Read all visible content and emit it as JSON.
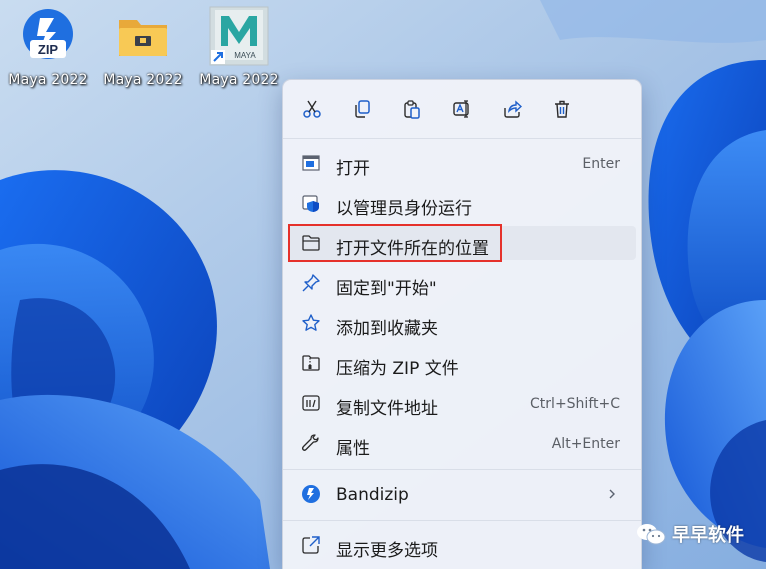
{
  "colors": {
    "accent": "#1f6fe0",
    "highlight_border": "#e5312b",
    "menu_bg": "#f0f3f9"
  },
  "desktop": {
    "icons": [
      {
        "label": "Maya 2022",
        "icon": "bandizip-zip-icon",
        "badge": "ZIP"
      },
      {
        "label": "Maya 2022",
        "icon": "folder-icon"
      },
      {
        "label": "Maya 2022",
        "icon": "maya-shortcut-icon",
        "badge": "MAYA"
      }
    ]
  },
  "context_menu": {
    "toolbar": [
      {
        "name": "cut",
        "icon": "scissors-icon"
      },
      {
        "name": "copy",
        "icon": "copy-icon"
      },
      {
        "name": "paste",
        "icon": "clipboard-icon"
      },
      {
        "name": "rename",
        "icon": "rename-icon"
      },
      {
        "name": "share",
        "icon": "share-icon"
      },
      {
        "name": "delete",
        "icon": "trash-icon"
      }
    ],
    "items": [
      {
        "label": "打开",
        "shortcut": "Enter",
        "icon": "open-window-icon"
      },
      {
        "label": "以管理员身份运行",
        "shortcut": "",
        "icon": "admin-shield-icon"
      },
      {
        "label": "打开文件所在的位置",
        "shortcut": "",
        "icon": "folder-outline-icon",
        "highlighted": true
      },
      {
        "label": "固定到\"开始\"",
        "shortcut": "",
        "icon": "pin-icon"
      },
      {
        "label": "添加到收藏夹",
        "shortcut": "",
        "icon": "star-icon"
      },
      {
        "label": "压缩为 ZIP 文件",
        "shortcut": "",
        "icon": "zip-folder-icon"
      },
      {
        "label": "复制文件地址",
        "shortcut": "Ctrl+Shift+C",
        "icon": "copy-path-icon"
      },
      {
        "label": "属性",
        "shortcut": "Alt+Enter",
        "icon": "wrench-icon"
      }
    ],
    "bandizip": {
      "label": "Bandizip",
      "icon": "bandizip-icon",
      "arrow": "chevron-right-icon"
    },
    "more_options": {
      "label": "显示更多选项",
      "icon": "external-open-icon"
    }
  },
  "watermark": {
    "text": "早早软件",
    "icon": "wechat-icon"
  }
}
